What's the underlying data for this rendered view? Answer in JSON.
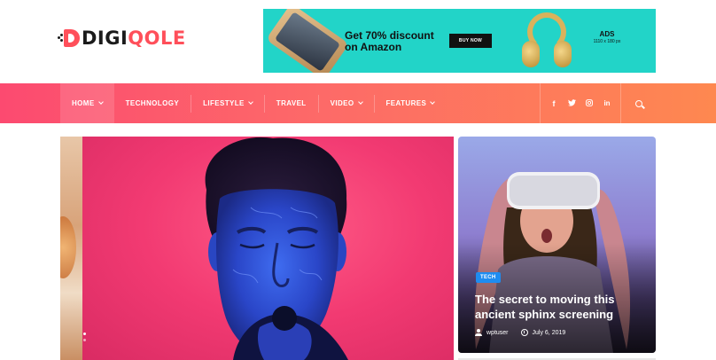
{
  "logo": {
    "prefix": "DIGI",
    "accent": "QOLE"
  },
  "ad": {
    "title": "Get 70% discount on Amazon",
    "button": "BUY NOW",
    "label": "ADS",
    "size": "1110 x 180 px"
  },
  "nav": {
    "items": [
      {
        "label": "HOME",
        "dropdown": true,
        "active": true
      },
      {
        "label": "TECHNOLOGY",
        "dropdown": false
      },
      {
        "label": "LIFESTYLE",
        "dropdown": true
      },
      {
        "label": "TRAVEL",
        "dropdown": false
      },
      {
        "label": "VIDEO",
        "dropdown": true
      },
      {
        "label": "FEATURES",
        "dropdown": true
      }
    ],
    "social": [
      "f",
      "t",
      "ig",
      "in"
    ],
    "social_icons": [
      "facebook-icon",
      "twitter-icon",
      "instagram-icon",
      "linkedin-icon"
    ]
  },
  "featured": {
    "tag": "TECH",
    "title": "The secret to moving this ancient sphinx screening",
    "author": "wptuser",
    "date": "July 6, 2019"
  },
  "colors": {
    "accent": "#ff4f5a",
    "nav_start": "#fc4a70",
    "nav_end": "#fe8850",
    "ad_bg": "#22d4c8",
    "tag_bg": "#1e8cf0"
  }
}
